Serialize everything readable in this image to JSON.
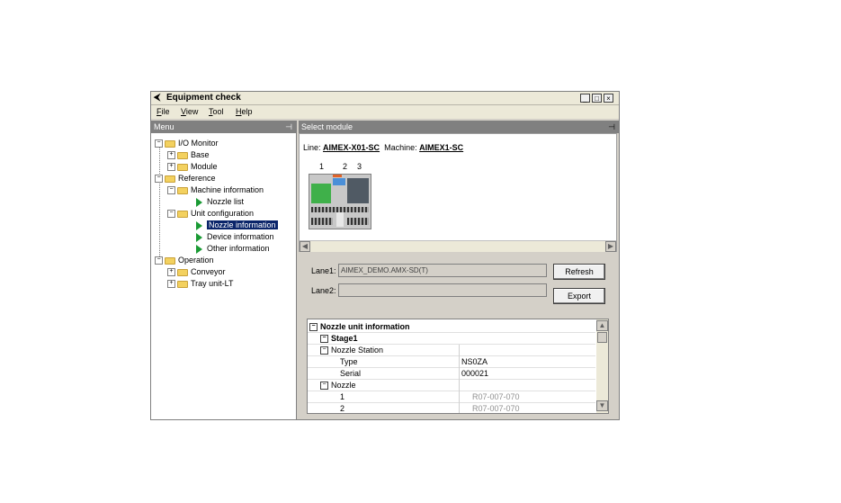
{
  "window": {
    "title": "Equipment check",
    "controls": [
      "_",
      "□",
      "×"
    ]
  },
  "menubar": [
    {
      "key": "F",
      "rest": "ile"
    },
    {
      "key": "V",
      "rest": "iew"
    },
    {
      "key": "T",
      "rest": "ool"
    },
    {
      "key": "H",
      "rest": "elp"
    }
  ],
  "left_pane": {
    "header": "Menu",
    "tree": [
      {
        "label": "I/O Monitor",
        "kind": "folder",
        "exp": "−"
      },
      {
        "label": "Base",
        "kind": "folder",
        "exp": "+"
      },
      {
        "label": "Module",
        "kind": "folder",
        "exp": "+"
      },
      {
        "label": "Reference",
        "kind": "folder",
        "exp": "−"
      },
      {
        "label": "Machine information",
        "kind": "folder",
        "exp": "−"
      },
      {
        "label": "Nozzle list",
        "kind": "item"
      },
      {
        "label": "Unit configuration",
        "kind": "folder",
        "exp": "−"
      },
      {
        "label": "Nozzle information",
        "kind": "item",
        "selected": true
      },
      {
        "label": "Device information",
        "kind": "item"
      },
      {
        "label": "Other information",
        "kind": "item"
      },
      {
        "label": "Operation",
        "kind": "folder",
        "exp": "−"
      },
      {
        "label": "Conveyor",
        "kind": "folder",
        "exp": "+"
      },
      {
        "label": "Tray unit-LT",
        "kind": "folder",
        "exp": "+"
      }
    ]
  },
  "right_pane": {
    "header": "Select module",
    "line_label": "Line:",
    "line_value": "AIMEX-X01-SC",
    "machine_label": "Machine:",
    "machine_value": "AIMEX1-SC",
    "module_numbers": [
      "1",
      "2",
      "3"
    ],
    "lane1_label": "Lane1:",
    "lane1_value": "AIMEX_DEMO.AMX-SD(T)",
    "lane2_label": "Lane2:",
    "lane2_value": "",
    "refresh_button": "Refresh",
    "export_button": "Export",
    "grid_rows": [
      {
        "c1": "Nozzle unit information",
        "c2": "",
        "exp": "−",
        "bold": true
      },
      {
        "c1": "Stage1",
        "c2": "",
        "exp": "−",
        "bold": true
      },
      {
        "c1": "Nozzle Station",
        "c2": "",
        "exp": "−"
      },
      {
        "c1": "Type",
        "c2": "NS0ZA"
      },
      {
        "c1": "Serial",
        "c2": "000021"
      },
      {
        "c1": "Nozzle",
        "c2": "",
        "exp": "−"
      },
      {
        "c1": "1",
        "c2": "R07-007-070",
        "grey": true
      },
      {
        "c1": "2",
        "c2": "R07-007-070",
        "grey": true
      }
    ]
  },
  "colors": {
    "selection": "#0a246a",
    "arrow": "#1a9a34",
    "folder": "#f3d15f"
  }
}
